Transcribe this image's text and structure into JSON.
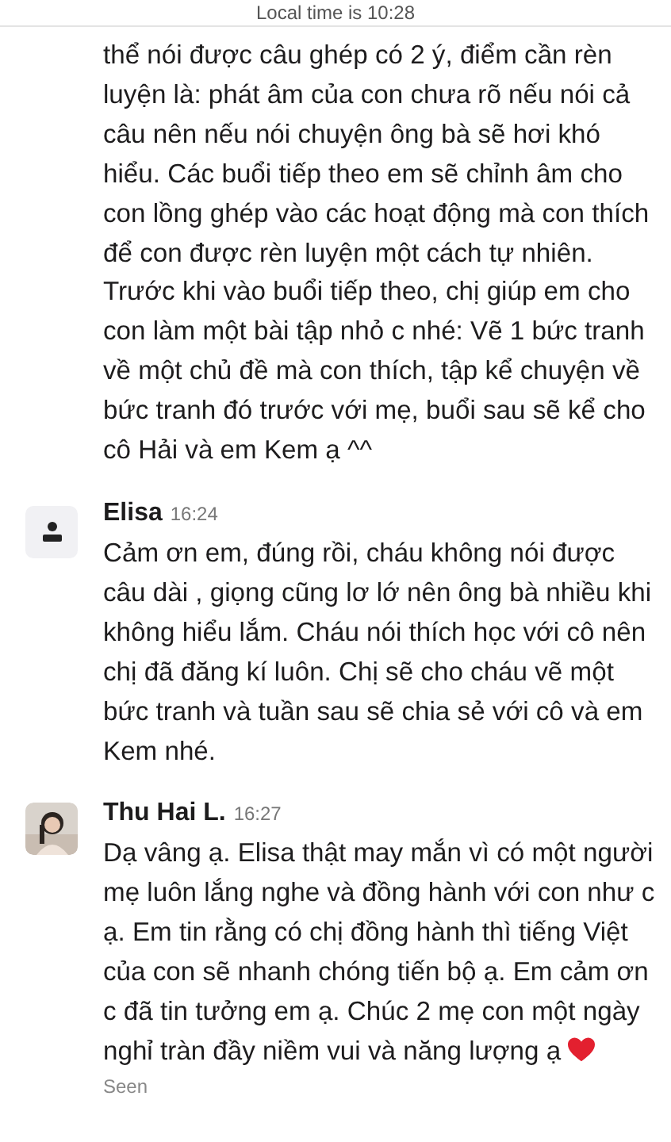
{
  "header": {
    "local_time": "Local time is 10:28"
  },
  "messages": [
    {
      "kind": "continued",
      "text": "thể nói được câu ghép có 2 ý, điểm cần rèn luyện là: phát âm của con chưa rõ nếu nói cả câu nên nếu nói chuyện ông bà sẽ hơi khó hiểu. Các buổi tiếp theo em sẽ chỉnh âm cho con lồng ghép vào các hoạt động mà con thích để con được rèn luyện một cách tự nhiên. Trước khi vào buổi tiếp theo, chị giúp em cho con làm một bài tập nhỏ c nhé: Vẽ 1 bức tranh về một chủ đề mà con thích, tập kể chuyện về bức tranh đó trước với mẹ, buổi sau sẽ kể cho cô Hải và em Kem ạ ^^"
    },
    {
      "kind": "placeholder",
      "author": "Elisa",
      "time": "16:24",
      "text": "Cảm ơn em, đúng rồi, cháu không nói được câu dài , giọng cũng lơ lớ nên ông bà nhiều khi không hiểu lắm. Cháu nói thích học với cô nên chị đã đăng kí luôn.  Chị sẽ cho cháu vẽ một bức tranh và tuần sau sẽ chia sẻ với cô và em Kem nhé."
    },
    {
      "author": "Thu Hai L.",
      "time": "16:27",
      "text": "Dạ vâng ạ. Elisa thật may mắn vì có một người mẹ luôn lắng nghe và đồng hành với con như c ạ. Em tin rằng có chị đồng hành thì tiếng Việt của con sẽ nhanh chóng tiến bộ ạ. Em cảm ơn c đã tin tưởng em ạ. Chúc 2 mẹ con một ngày nghỉ tràn đầy niềm vui và năng lượng ạ",
      "heart": true,
      "status": "Seen"
    }
  ]
}
